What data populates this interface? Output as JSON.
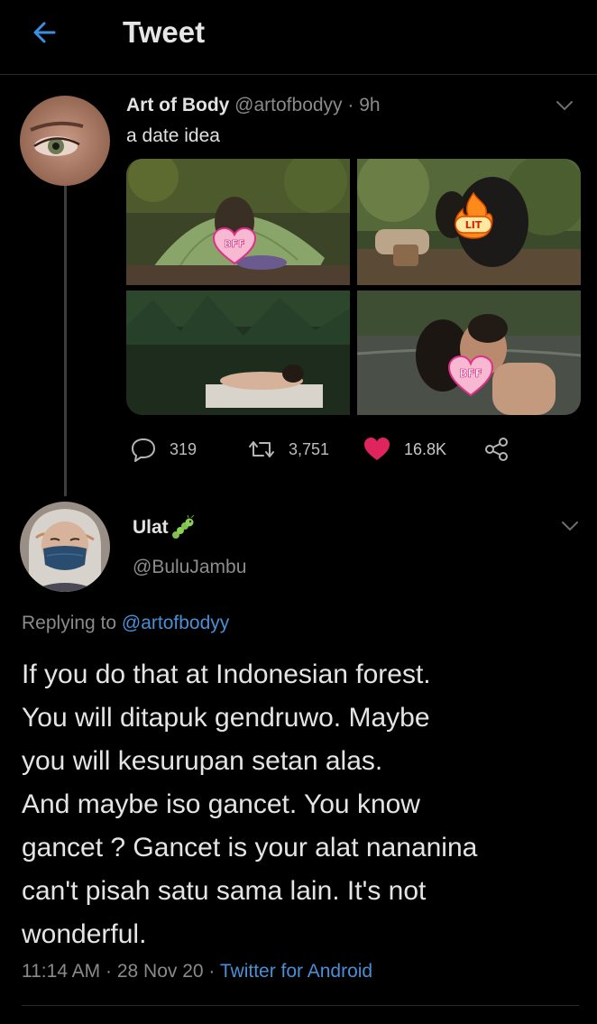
{
  "header": {
    "title": "Tweet"
  },
  "tweet": {
    "author_name": "Art of Body",
    "author_handle": "@artofbodyy",
    "time": "· 9h",
    "text": "a date idea",
    "stickers": [
      "BFF",
      "LIT",
      "BFF"
    ],
    "stats": {
      "replies": "319",
      "retweets": "3,751",
      "likes": "16.8K"
    }
  },
  "reply": {
    "author_name": "Ulat",
    "author_emoji_icon": "caterpillar-icon",
    "author_handle": "@BuluJambu",
    "replying_prefix": "Replying to",
    "replying_to": "@artofbodyy",
    "lines": [
      "If you do that at Indonesian forest.",
      "You will ditapuk gendruwo. Maybe",
      "you will kesurupan setan alas.",
      "And maybe iso gancet. You know",
      "gancet ? Gancet is your alat nananina",
      "can't pisah satu sama lain. It's not",
      "wonderful."
    ],
    "timestamp": "11:14 AM · 28 Nov 20 ·",
    "source": "Twitter for Android"
  },
  "colors": {
    "background": "#000000",
    "link": "#4a8fd6",
    "like": "#e0245e",
    "muted": "#8a8a8a"
  }
}
